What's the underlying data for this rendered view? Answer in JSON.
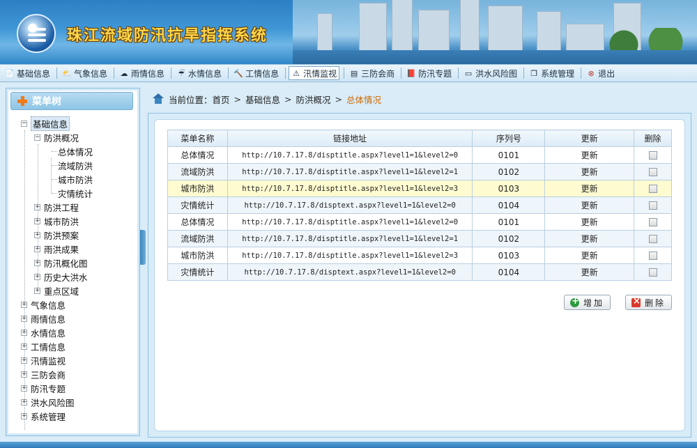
{
  "app": {
    "title": "珠江流域防汛抗旱指挥系统"
  },
  "nav": {
    "items": [
      {
        "label": "基础信息",
        "icon": "document-icon"
      },
      {
        "label": "气象信息",
        "icon": "weather-icon"
      },
      {
        "label": "雨情信息",
        "icon": "cloud-icon"
      },
      {
        "label": "水情信息",
        "icon": "rain-icon"
      },
      {
        "label": "工情信息",
        "icon": "tool-icon"
      },
      {
        "label": "汛情监视",
        "icon": "warning-icon",
        "active": true
      },
      {
        "label": "三防会商",
        "icon": "meeting-icon"
      },
      {
        "label": "防汛专题",
        "icon": "book-icon"
      },
      {
        "label": "洪水风险图",
        "icon": "monitor-icon"
      },
      {
        "label": "系统管理",
        "icon": "window-icon"
      },
      {
        "label": "退出",
        "icon": "exit-icon"
      }
    ]
  },
  "sidebar": {
    "title": "菜单树",
    "tree": {
      "root": "基础信息",
      "group": "防洪概况",
      "leaves": [
        "总体情况",
        "流域防洪",
        "城市防洪",
        "灾情统计"
      ],
      "siblings": [
        "防洪工程",
        "城市防洪",
        "防洪预案",
        "雨洪成果",
        "防汛概化图",
        "历史大洪水",
        "重点区域"
      ],
      "top": [
        "气象信息",
        "雨情信息",
        "水情信息",
        "工情信息",
        "汛情监视",
        "三防会商",
        "防汛专题",
        "洪水风险图",
        "系统管理"
      ]
    }
  },
  "breadcrumb": {
    "prefix": "当前位置：",
    "items": [
      "首页",
      "基础信息",
      "防洪概况"
    ],
    "current": "总体情况",
    "separator": ">"
  },
  "table": {
    "headers": [
      "菜单名称",
      "链接地址",
      "序列号",
      "更新",
      "删除"
    ],
    "rows": [
      {
        "name": "总体情况",
        "url": "http://10.7.17.8/disptitle.aspx?level1=1&level2=0",
        "seq": "0101",
        "update": "更新"
      },
      {
        "name": "流域防洪",
        "url": "http://10.7.17.8/disptitle.aspx?level1=1&level2=1",
        "seq": "0102",
        "update": "更新"
      },
      {
        "name": "城市防洪",
        "url": "http://10.7.17.8/disptitle.aspx?level1=1&level2=3",
        "seq": "0103",
        "update": "更新"
      },
      {
        "name": "灾情统计",
        "url": "http://10.7.17.8/disptext.aspx?level1=1&level2=0",
        "seq": "0104",
        "update": "更新"
      },
      {
        "name": "总体情况",
        "url": "http://10.7.17.8/disptitle.aspx?level1=1&level2=0",
        "seq": "0101",
        "update": "更新"
      },
      {
        "name": "流域防洪",
        "url": "http://10.7.17.8/disptitle.aspx?level1=1&level2=1",
        "seq": "0102",
        "update": "更新"
      },
      {
        "name": "城市防洪",
        "url": "http://10.7.17.8/disptitle.aspx?level1=1&level2=3",
        "seq": "0103",
        "update": "更新"
      },
      {
        "name": "灾情统计",
        "url": "http://10.7.17.8/disptext.aspx?level1=1&level2=0",
        "seq": "0104",
        "update": "更新"
      }
    ]
  },
  "buttons": {
    "add": "增加",
    "delete": "删除"
  },
  "colors": {
    "accent": "#2f86c8",
    "highlight_row": "#fffbd0",
    "current_crumb": "#d16a00",
    "title_text": "#ffd84a"
  }
}
